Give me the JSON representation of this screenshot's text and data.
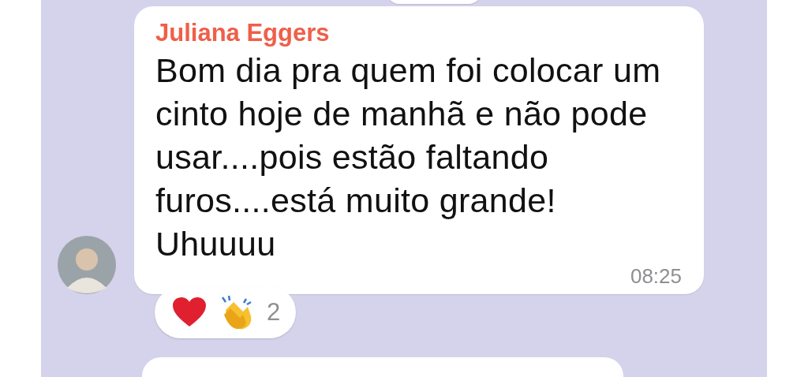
{
  "message": {
    "sender": "Juliana Eggers",
    "text": "Bom dia pra quem foi colocar um cinto hoje de manhã e não pode usar....pois estão faltando furos....está muito grande! Uhuuuu",
    "time": "08:25",
    "reactions": {
      "count": "2"
    }
  }
}
